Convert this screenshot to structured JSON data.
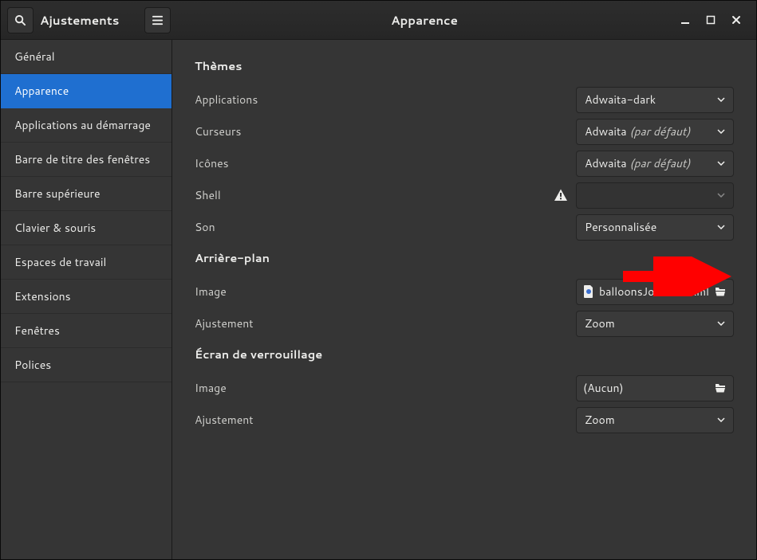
{
  "header": {
    "app_title": "Ajustements",
    "page_title": "Apparence"
  },
  "sidebar": {
    "items": [
      "Général",
      "Apparence",
      "Applications au démarrage",
      "Barre de titre des fenêtres",
      "Barre supérieure",
      "Clavier & souris",
      "Espaces de travail",
      "Extensions",
      "Fenêtres",
      "Polices"
    ],
    "active_index": 1
  },
  "sections": {
    "themes_title": "Thèmes",
    "bg_title": "Arrière-plan",
    "lock_title": "Écran de verrouillage"
  },
  "rows": {
    "applications": {
      "label": "Applications",
      "value": "Adwaita-dark"
    },
    "cursor": {
      "label": "Curseurs",
      "value_prefix": "Adwaita ",
      "value_suffix": "(par défaut)"
    },
    "icons": {
      "label": "Icônes",
      "value_prefix": "Adwaita ",
      "value_suffix": "(par défaut)"
    },
    "shell": {
      "label": "Shell",
      "value": ""
    },
    "sound": {
      "label": "Son",
      "value": "Personnalisée"
    },
    "bg_image": {
      "label": "Image",
      "file": "balloonsJourNuit.xml"
    },
    "bg_adjust": {
      "label": "Ajustement",
      "value": "Zoom"
    },
    "lock_image": {
      "label": "Image",
      "file": "(Aucun)"
    },
    "lock_adjust": {
      "label": "Ajustement",
      "value": "Zoom"
    }
  }
}
